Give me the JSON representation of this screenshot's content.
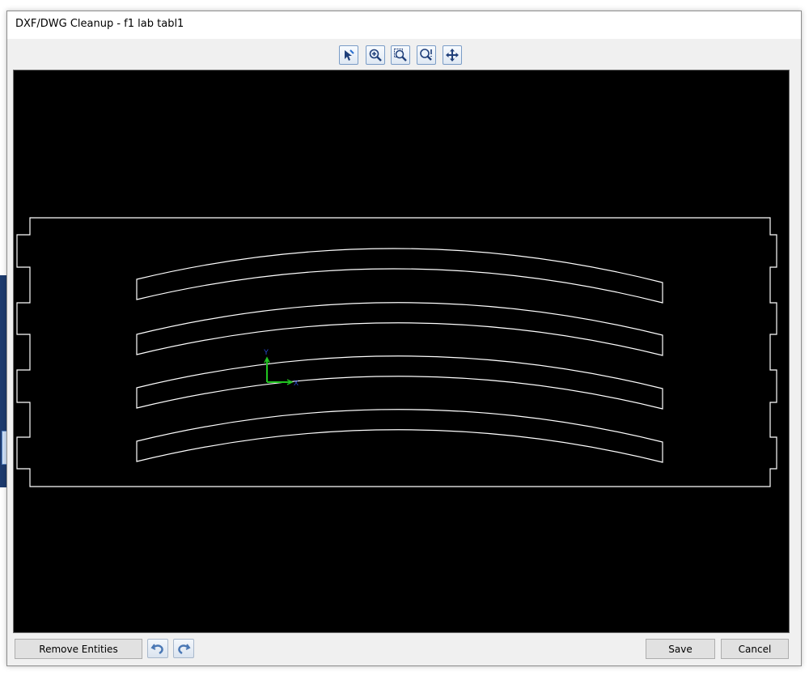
{
  "window": {
    "title": "DXF/DWG Cleanup - f1 lab tabl1"
  },
  "toolbar": {
    "tools": [
      {
        "icon": "select-entity-icon"
      },
      {
        "icon": "zoom-in-icon"
      },
      {
        "icon": "zoom-window-icon"
      },
      {
        "icon": "zoom-extents-icon"
      },
      {
        "icon": "pan-icon"
      }
    ]
  },
  "viewport": {
    "background": "#000000",
    "entity_color": "#ffffff",
    "axis": {
      "x_label": "X",
      "y_label": "Y",
      "x_color": "#21c521",
      "y_color": "#21c521",
      "label_color": "#2a4bd7"
    }
  },
  "actions": {
    "remove_entities_label": "Remove Entities",
    "undo_icon": "undo-icon",
    "redo_icon": "redo-icon",
    "save_label": "Save",
    "cancel_label": "Cancel"
  }
}
